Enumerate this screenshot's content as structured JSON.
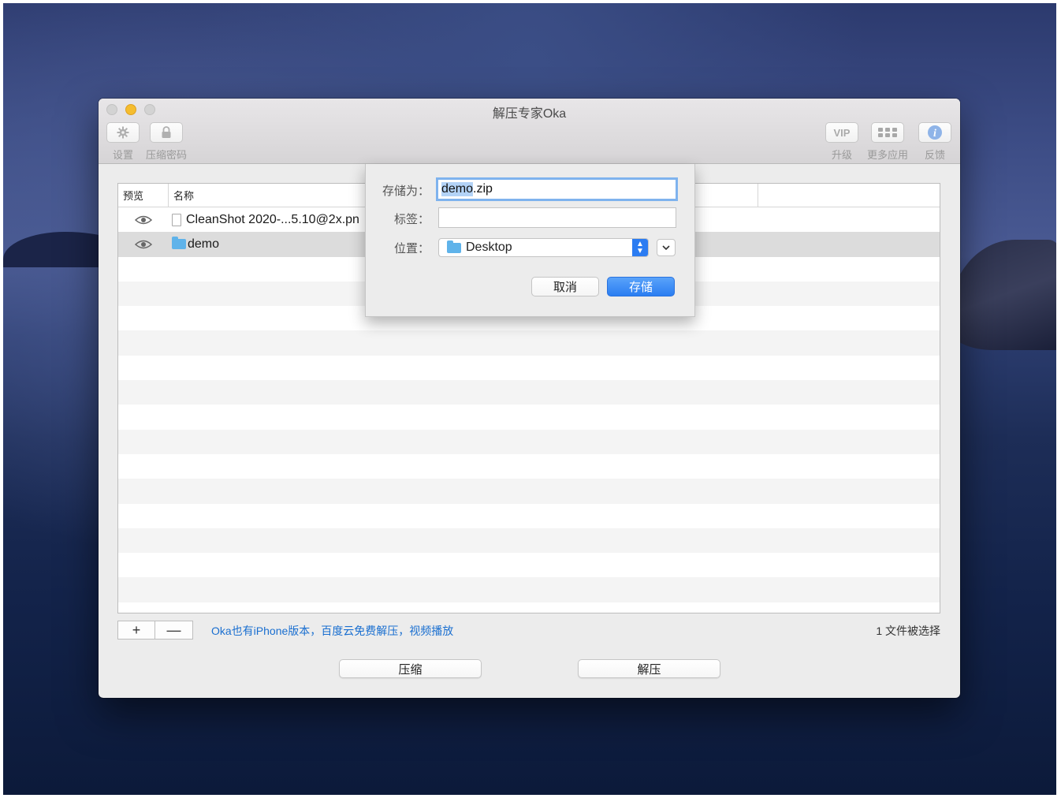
{
  "window": {
    "title": "解压专家Oka"
  },
  "toolbar": {
    "left": [
      {
        "label": "设置",
        "icon": "gear-icon"
      },
      {
        "label": "压缩密码",
        "icon": "lock-icon"
      }
    ],
    "right": [
      {
        "label": "升级",
        "icon_text": "VIP"
      },
      {
        "label": "更多应用",
        "icon": "grid-icon"
      },
      {
        "label": "反馈",
        "icon": "info-icon"
      }
    ]
  },
  "list": {
    "columns": [
      "预览",
      "名称"
    ],
    "rows": [
      {
        "name": "CleanShot 2020-...5.10@2x.pn",
        "type": "file"
      },
      {
        "name": "demo",
        "type": "folder",
        "selected": true
      }
    ]
  },
  "bottom": {
    "add": "+",
    "remove": "—",
    "promo": "Oka也有iPhone版本，百度云免费解压，视频播放",
    "selection_status": "1 文件被选择"
  },
  "actions": {
    "compress": "压缩",
    "extract": "解压"
  },
  "save_sheet": {
    "save_as_label": "存储为：",
    "filename_selected": "demo",
    "filename_rest": ".zip",
    "tags_label": "标签：",
    "tags_value": "",
    "location_label": "位置：",
    "location_value": "Desktop",
    "cancel": "取消",
    "save": "存储"
  },
  "colors": {
    "accent": "#2b7cf2",
    "link": "#1a6fd0",
    "selection_highlight": "#b3d3f7"
  }
}
